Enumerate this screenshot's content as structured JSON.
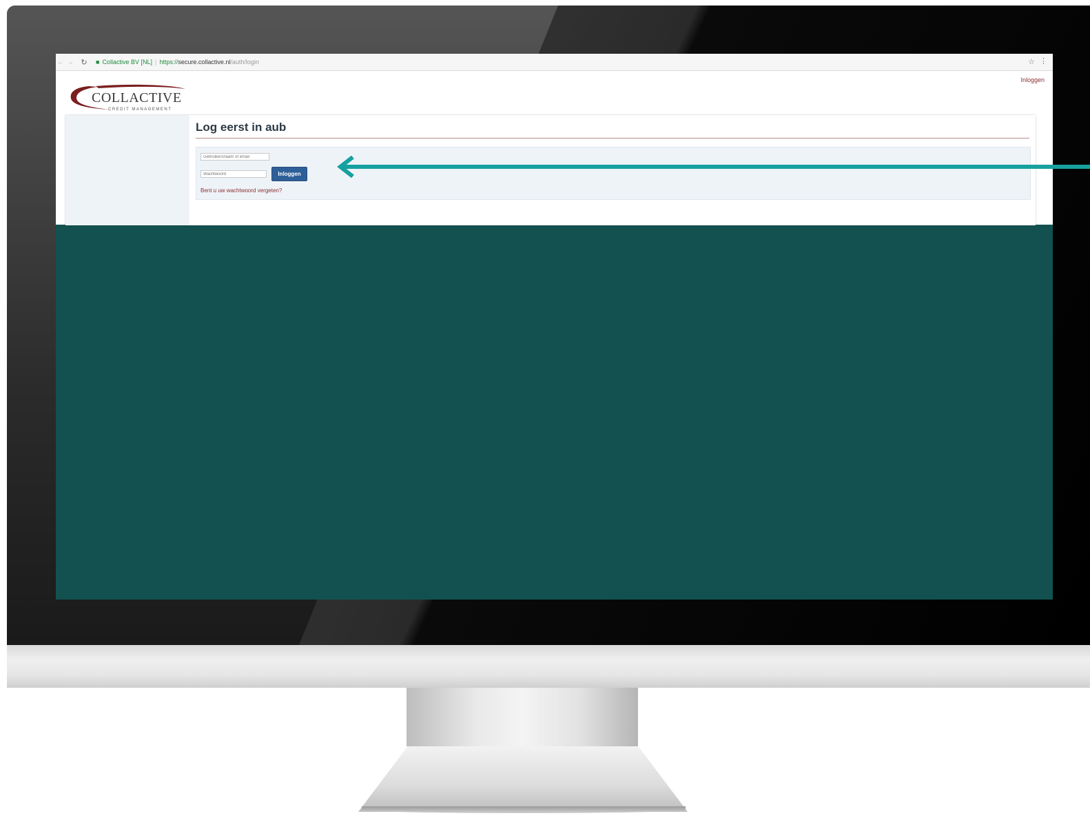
{
  "browser": {
    "site_identity": "Collactive BV [NL]",
    "url_scheme": "https://",
    "url_host": "secure.collactive.nl",
    "url_path": "/auth/login",
    "lock_icon": "lock-icon",
    "star_icon": "star-icon",
    "menu_icon": "menu-icon"
  },
  "header": {
    "logo_text": "COLLACTIVE",
    "logo_subtitle": "CREDIT MANAGEMENT",
    "login_link": "Inloggen"
  },
  "main": {
    "title": "Log eerst in aub",
    "form": {
      "username_placeholder": "Gebruikersnaam of email",
      "password_placeholder": "Wachtwoord",
      "submit_label": "Inloggen",
      "forgot_link": "Bent u uw wachtwoord vergeten?"
    }
  },
  "colors": {
    "screen_background": "#135150",
    "button_blue": "#2f5f98",
    "link_red": "#8a3030",
    "arrow_teal": "#16a0a0"
  }
}
